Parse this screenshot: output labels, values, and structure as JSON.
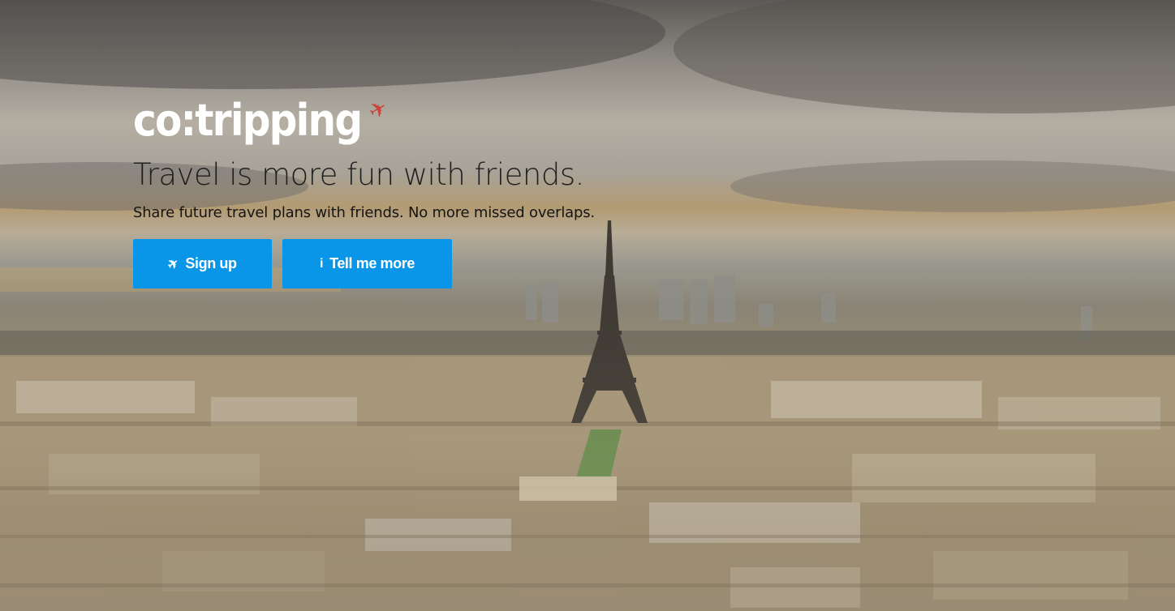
{
  "brand": {
    "logo_text": "co:tripping",
    "logo_plane_icon": "airplane-icon",
    "logo_plane_color": "#c9443a"
  },
  "hero": {
    "tagline": "Travel is more fun with friends.",
    "subline": "Share future travel plans with friends. No more missed overlaps."
  },
  "actions": {
    "signup": {
      "icon": "airplane-icon",
      "icon_glyph": "✈",
      "label": "Sign up"
    },
    "more": {
      "icon": "info-icon",
      "icon_glyph": "i",
      "label": "Tell me more"
    },
    "accent_color": "#0a96e8"
  }
}
